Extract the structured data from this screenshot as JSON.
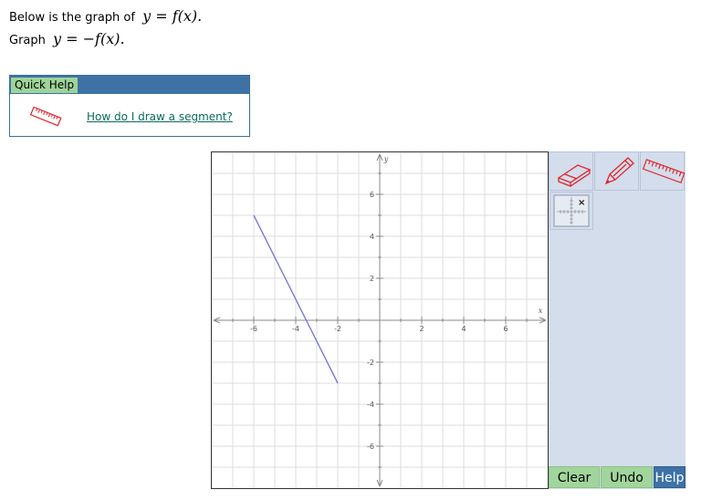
{
  "problem": {
    "line1_text": "Below is the graph of",
    "line1_math": "y = f(x).",
    "line2_text": "Graph",
    "line2_math": "y = −f(x)."
  },
  "quick_help": {
    "tab_label": "Quick Help",
    "link_text": "How do I draw a segment?"
  },
  "graph": {
    "x_axis_label": "x",
    "y_axis_label": "y",
    "x_range": [
      -8,
      8
    ],
    "y_range": [
      -8,
      8
    ],
    "x_tick_labels": [
      "-6",
      "-4",
      "-2",
      "2",
      "4",
      "6"
    ],
    "y_tick_labels": [
      "6",
      "4",
      "2",
      "-2",
      "-4",
      "-6"
    ],
    "segment": {
      "from": [
        -6,
        5
      ],
      "to": [
        -2,
        -3
      ]
    },
    "segment_color": "#7b7bd6"
  },
  "tools": {
    "eraser_icon": "eraser-icon",
    "pencil_icon": "pencil-icon",
    "ruler_icon": "ruler-icon",
    "grid_icon": "grid-toggle-icon"
  },
  "buttons": {
    "clear": "Clear",
    "undo": "Undo",
    "help": "Help"
  },
  "colors": {
    "panel_bg": "#d3ddec",
    "green_button": "#a2d59c",
    "blue_button": "#3e72a6",
    "tool_red": "#e0252b"
  }
}
